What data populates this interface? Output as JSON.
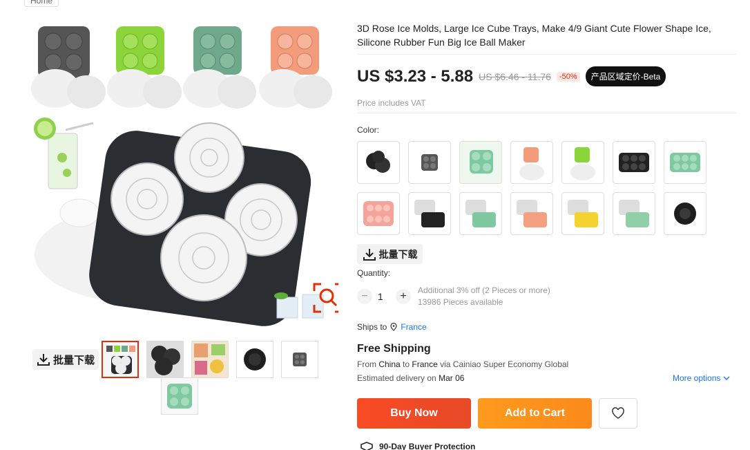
{
  "breadcrumb": {
    "label": "Home"
  },
  "product": {
    "title": "3D Rose Ice Molds, Large Ice Cube Trays, Make 4/9 Giant Cute Flower Shape Ice, Silicone Rubber Fun Big Ice Ball Maker",
    "price": "US $3.23 - 5.88",
    "old_price": "US $6.46 - 11.76",
    "discount": "-50%",
    "beta_badge": "产品区域定价-Beta",
    "vat_note": "Price includes VAT"
  },
  "gallery": {
    "bulk_download_label": "批量下载",
    "thumbnails": [
      {
        "name": "thumb-1",
        "color": "#e8e8e8"
      },
      {
        "name": "thumb-2",
        "color": "#2a2a2a"
      },
      {
        "name": "thumb-3",
        "color": "#d9b48c"
      },
      {
        "name": "thumb-4",
        "color": "#1e1e1e"
      },
      {
        "name": "thumb-5",
        "color": "#555"
      },
      {
        "name": "thumb-6",
        "color": "#7fc9a0"
      }
    ]
  },
  "variants": {
    "label": "Color:",
    "swatches": [
      "black",
      "grey",
      "green",
      "orange",
      "lime",
      "black-9",
      "green-9",
      "pink-9",
      "grey-clear",
      "green-clear",
      "orange-clear",
      "yellow-clear",
      "green-clear-2",
      "black-single"
    ]
  },
  "bulk_download_label": "批量下载",
  "quantity": {
    "label": "Quantity:",
    "value": "1",
    "minus": "−",
    "plus": "+",
    "discount_note": "Additional 3% off (2 Pieces or more)",
    "available": "13986 Pieces available"
  },
  "shipping": {
    "ships_to_label": "Ships to",
    "ships_to_country": "France",
    "free_shipping": "Free Shipping",
    "from_text_1": "From",
    "from_country": "China",
    "from_text_2": "to",
    "to_country": "France",
    "from_text_3": "via Cainiao Super Economy Global",
    "delivery_label": "Estimated delivery on",
    "delivery_date": "Mar 06",
    "more_options": "More options"
  },
  "actions": {
    "buy_now": "Buy Now",
    "add_to_cart": "Add to Cart"
  },
  "protection": {
    "label": "90-Day Buyer Protection"
  },
  "colors": {
    "accent": "#e62e04",
    "buy": "#f74b24",
    "cart": "#fe9a1e",
    "link": "#1a73e8"
  }
}
